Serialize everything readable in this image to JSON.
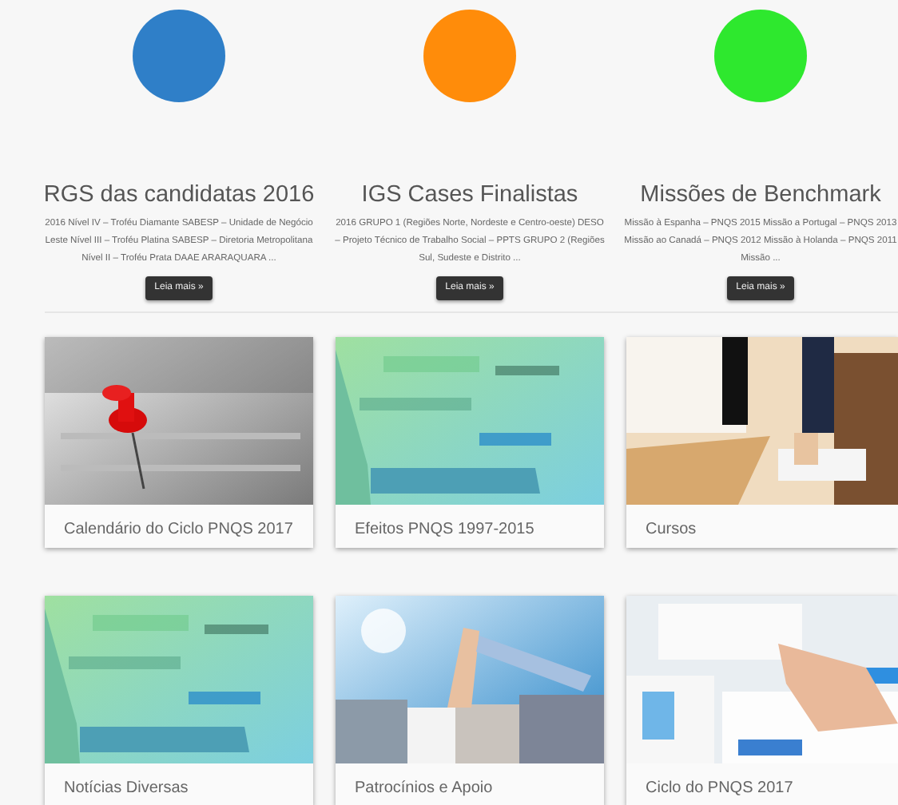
{
  "features": [
    {
      "color": "#2f7fc8",
      "title": "RGS das candidatas 2016",
      "summary": "2016 Nível IV – Troféu Diamante SABESP – Unidade de Negócio Leste Nível III – Troféu Platina SABESP – Diretoria Metropolitana Nível II – Troféu Prata DAAE ARARAQUARA ...",
      "button": "Leia mais »"
    },
    {
      "color": "#ff8c0a",
      "title": "IGS Cases Finalistas",
      "summary": "2016     GRUPO 1 (Regiões Norte, Nordeste e Centro-oeste) DESO – Projeto Técnico de Trabalho Social – PPTS     GRUPO 2 (Regiões Sul, Sudeste e Distrito ...",
      "button": "Leia mais »"
    },
    {
      "color": "#2ee82e",
      "title": "Missões de Benchmark",
      "summary": "Missão à Espanha – PNQS 2015 Missão a Portugal – PNQS 2013 Missão ao Canadá – PNQS 2012 Missão à Holanda – PNQS 2011 Missão ...",
      "button": "Leia mais »"
    }
  ],
  "cards": [
    {
      "kind": "calendar",
      "caption": "Calendário do Ciclo PNQS 2017"
    },
    {
      "kind": "news",
      "caption": "Efeitos PNQS 1997-2015"
    },
    {
      "kind": "classroom",
      "caption": "Cursos"
    },
    {
      "kind": "news",
      "caption": "Notícias Diversas"
    },
    {
      "kind": "team",
      "caption": "Patrocínios e Apoio"
    },
    {
      "kind": "charts",
      "caption": "Ciclo do PNQS 2017"
    }
  ]
}
